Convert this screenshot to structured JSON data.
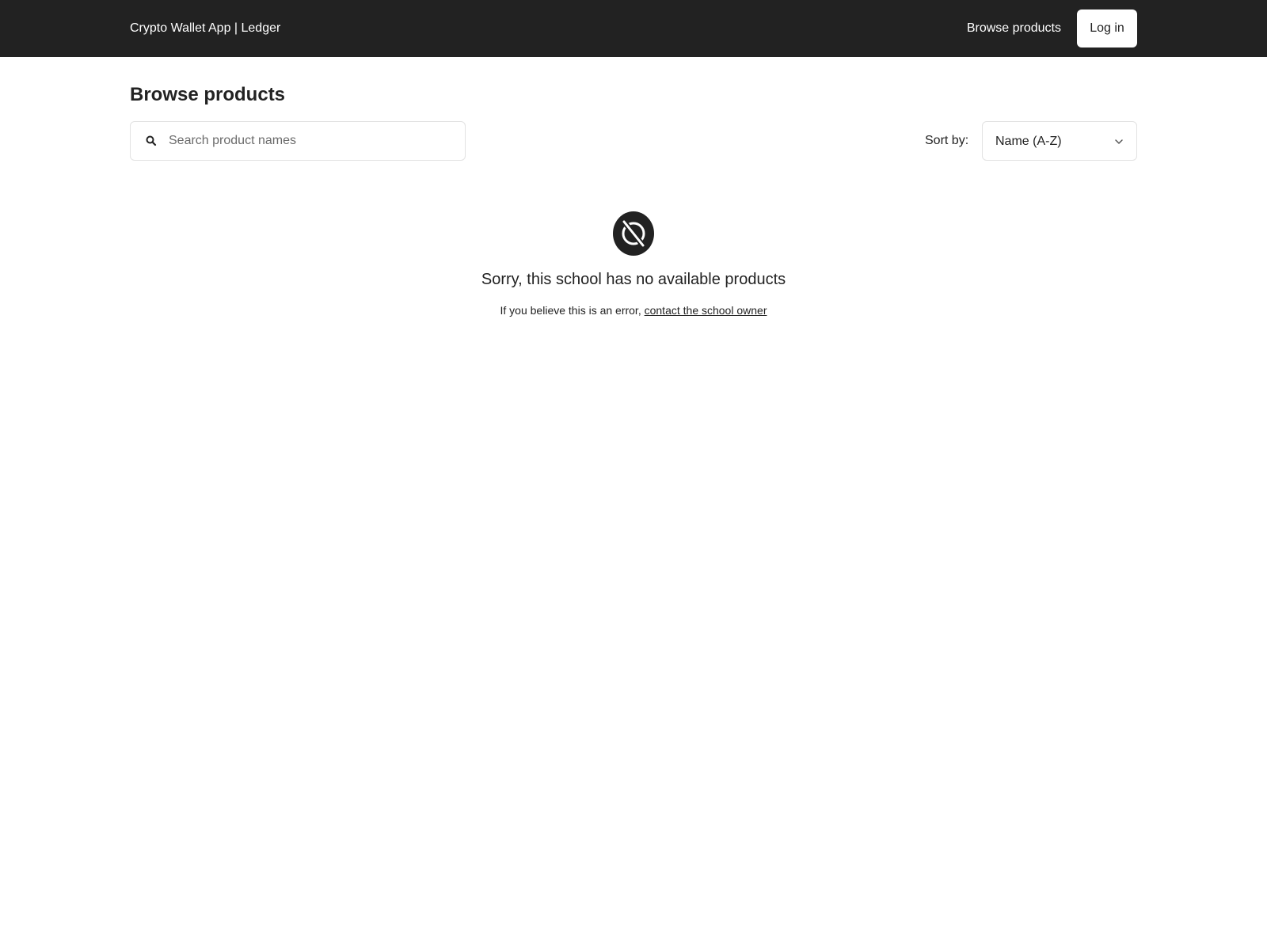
{
  "header": {
    "brand": "Crypto Wallet App | Ledger",
    "nav_browse": "Browse products",
    "login_label": "Log in"
  },
  "main": {
    "title": "Browse products",
    "search": {
      "placeholder": "Search product names",
      "value": ""
    },
    "sort": {
      "label": "Sort by:",
      "selected": "Name (A-Z)"
    },
    "empty_state": {
      "icon": "unavailable-icon",
      "title": "Sorry, this school has no available products",
      "message_prefix": "If you believe this is an error,",
      "contact_link": "contact the school owner"
    }
  },
  "colors": {
    "header_bg": "#222222",
    "text": "#222222",
    "border": "#e2e2e2",
    "background": "#ffffff"
  }
}
